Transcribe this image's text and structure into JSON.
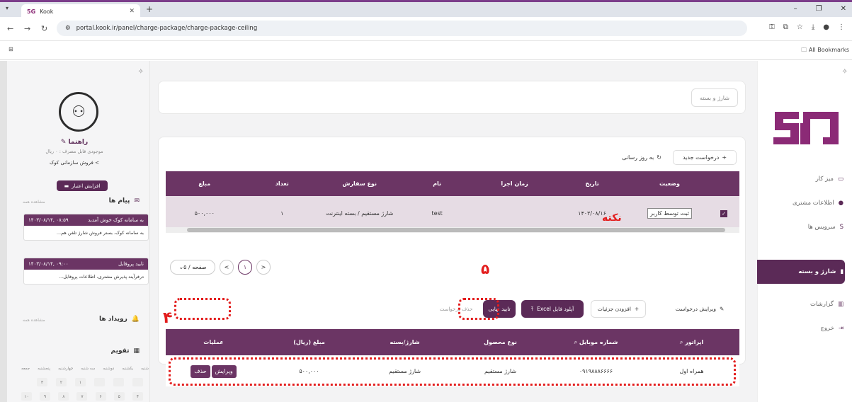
{
  "browser": {
    "tab_title": "Kook",
    "tab_favicon": "5G",
    "url": "portal.kook.ir/panel/charge-package/charge-package-ceiling",
    "all_bookmarks": "All Bookmarks"
  },
  "left": {
    "guide": "راهنما",
    "balance": "موجودی قابل مصرف : ۰ ریال",
    "sales": "فروش سازمانی کوک",
    "credit_button": "افزایش اعتبار",
    "messages_title": "پیام ها",
    "see_all": "مشاهده همه",
    "msg1": {
      "title": "به سامانه کوک خوش آمدید",
      "time": "۱۴۰۳/۰۸/۱۴, ۰۸:۵۹",
      "body": "به سامانه کوک، بستر فروش شارژ تلفن هم..."
    },
    "msg2": {
      "title": "تایید پروفایل",
      "time": "۱۴۰۳/۰۸/۱۴, ۰۹:۰۰",
      "body": "درفرآیند پذیرش مشتری، اطلاعات پروفایل..."
    },
    "events_title": "رویداد ها",
    "calendar_title": "تقویم",
    "weekdays": [
      "شنبه",
      "یکشنبه",
      "دوشنبه",
      "سه شنبه",
      "چهارشنبه",
      "پنجشنبه",
      "جمعه"
    ],
    "cal_row1": [
      "۳",
      "۲",
      "۱",
      "",
      "",
      ""
    ],
    "cal_row2": [
      "۱۰",
      "۹",
      "۸",
      "۷",
      "۶",
      "۵",
      "۴"
    ]
  },
  "main": {
    "breadcrumb": "شارژ و بسته",
    "new_request": "درخواست جدید",
    "refresh": "به روز رسانی",
    "table1": {
      "headers": [
        "وضعیت",
        "تاریخ",
        "زمان اجرا",
        "نام",
        "نوع سفارش",
        "تعداد",
        "مبلغ"
      ],
      "row": {
        "status": "ثبت توسط کاربر",
        "date": "۱۴۰۳/۰۸/۱۶",
        "time": "",
        "name": "test",
        "order_type": "شارژ مستقیم / بسته اینترنت",
        "count": "۱",
        "amount": "۵۰۰,۰۰۰"
      }
    },
    "pagination": {
      "page": "۱",
      "per_page": "۵ / صفحه"
    },
    "actions": {
      "edit_request": "ویرایش درخواست",
      "add_details": "افزودن جزئیات",
      "upload_excel": "آپلود فایل Excel",
      "final_confirm": "تایید نهایی",
      "delete_request": "حذف درخواست"
    },
    "table2": {
      "headers": [
        "اپراتور",
        "شماره موبایل",
        "نوع محصول",
        "شارژ/بسته",
        "مبلغ (ریال)",
        "عملیات"
      ],
      "row": {
        "operator": "همراه اول",
        "mobile": "۰۹۱۹۸۸۸۶۶۶۶",
        "product": "شارژ مستقیم",
        "charge": "شارژ مستقیم",
        "amount": "۵۰۰,۰۰۰",
        "edit": "ویرایش",
        "delete": "حذف"
      }
    }
  },
  "annotations": {
    "nokte": "نکته",
    "five": "۵",
    "four": "۴"
  },
  "right_nav": {
    "items": [
      {
        "label": "میز کار"
      },
      {
        "label": "اطلاعات مشتری"
      },
      {
        "label": "سرویس ها"
      },
      {
        "label": "شارژ و بسته"
      },
      {
        "label": "گزارشات"
      },
      {
        "label": "خروج"
      }
    ]
  },
  "colors": {
    "primary": "#6b3564",
    "annotation": "#e31d1d"
  }
}
